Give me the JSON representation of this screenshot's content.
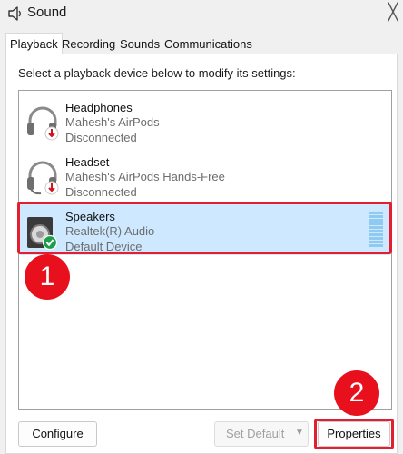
{
  "window": {
    "title": "Sound",
    "close_glyph": "╳"
  },
  "tabs": [
    {
      "label": "Playback",
      "active": true
    },
    {
      "label": "Recording",
      "active": false
    },
    {
      "label": "Sounds",
      "active": false
    },
    {
      "label": "Communications",
      "active": false
    }
  ],
  "instruction": "Select a playback device below to modify its settings:",
  "devices": [
    {
      "name": "Headphones",
      "detail": "Mahesh's AirPods",
      "status": "Disconnected",
      "icon": "headphones-icon",
      "badge": "disconnected-arrow-icon",
      "selected": false
    },
    {
      "name": "Headset",
      "detail": "Mahesh's AirPods Hands-Free",
      "status": "Disconnected",
      "icon": "headset-icon",
      "badge": "disconnected-arrow-icon",
      "selected": false
    },
    {
      "name": "Speakers",
      "detail": "Realtek(R) Audio",
      "status": "Default Device",
      "icon": "speaker-icon",
      "badge": "default-check-icon",
      "selected": true
    }
  ],
  "annotations": {
    "step1": "1",
    "step2": "2",
    "highlight_color": "#e31e2e"
  },
  "buttons": {
    "configure": "Configure",
    "set_default": "Set Default",
    "set_default_arrow": "▼",
    "properties": "Properties"
  },
  "colors": {
    "selected_row": "#cde8ff",
    "badge_red": "#e8101c",
    "check_green": "#1e9e4a"
  }
}
